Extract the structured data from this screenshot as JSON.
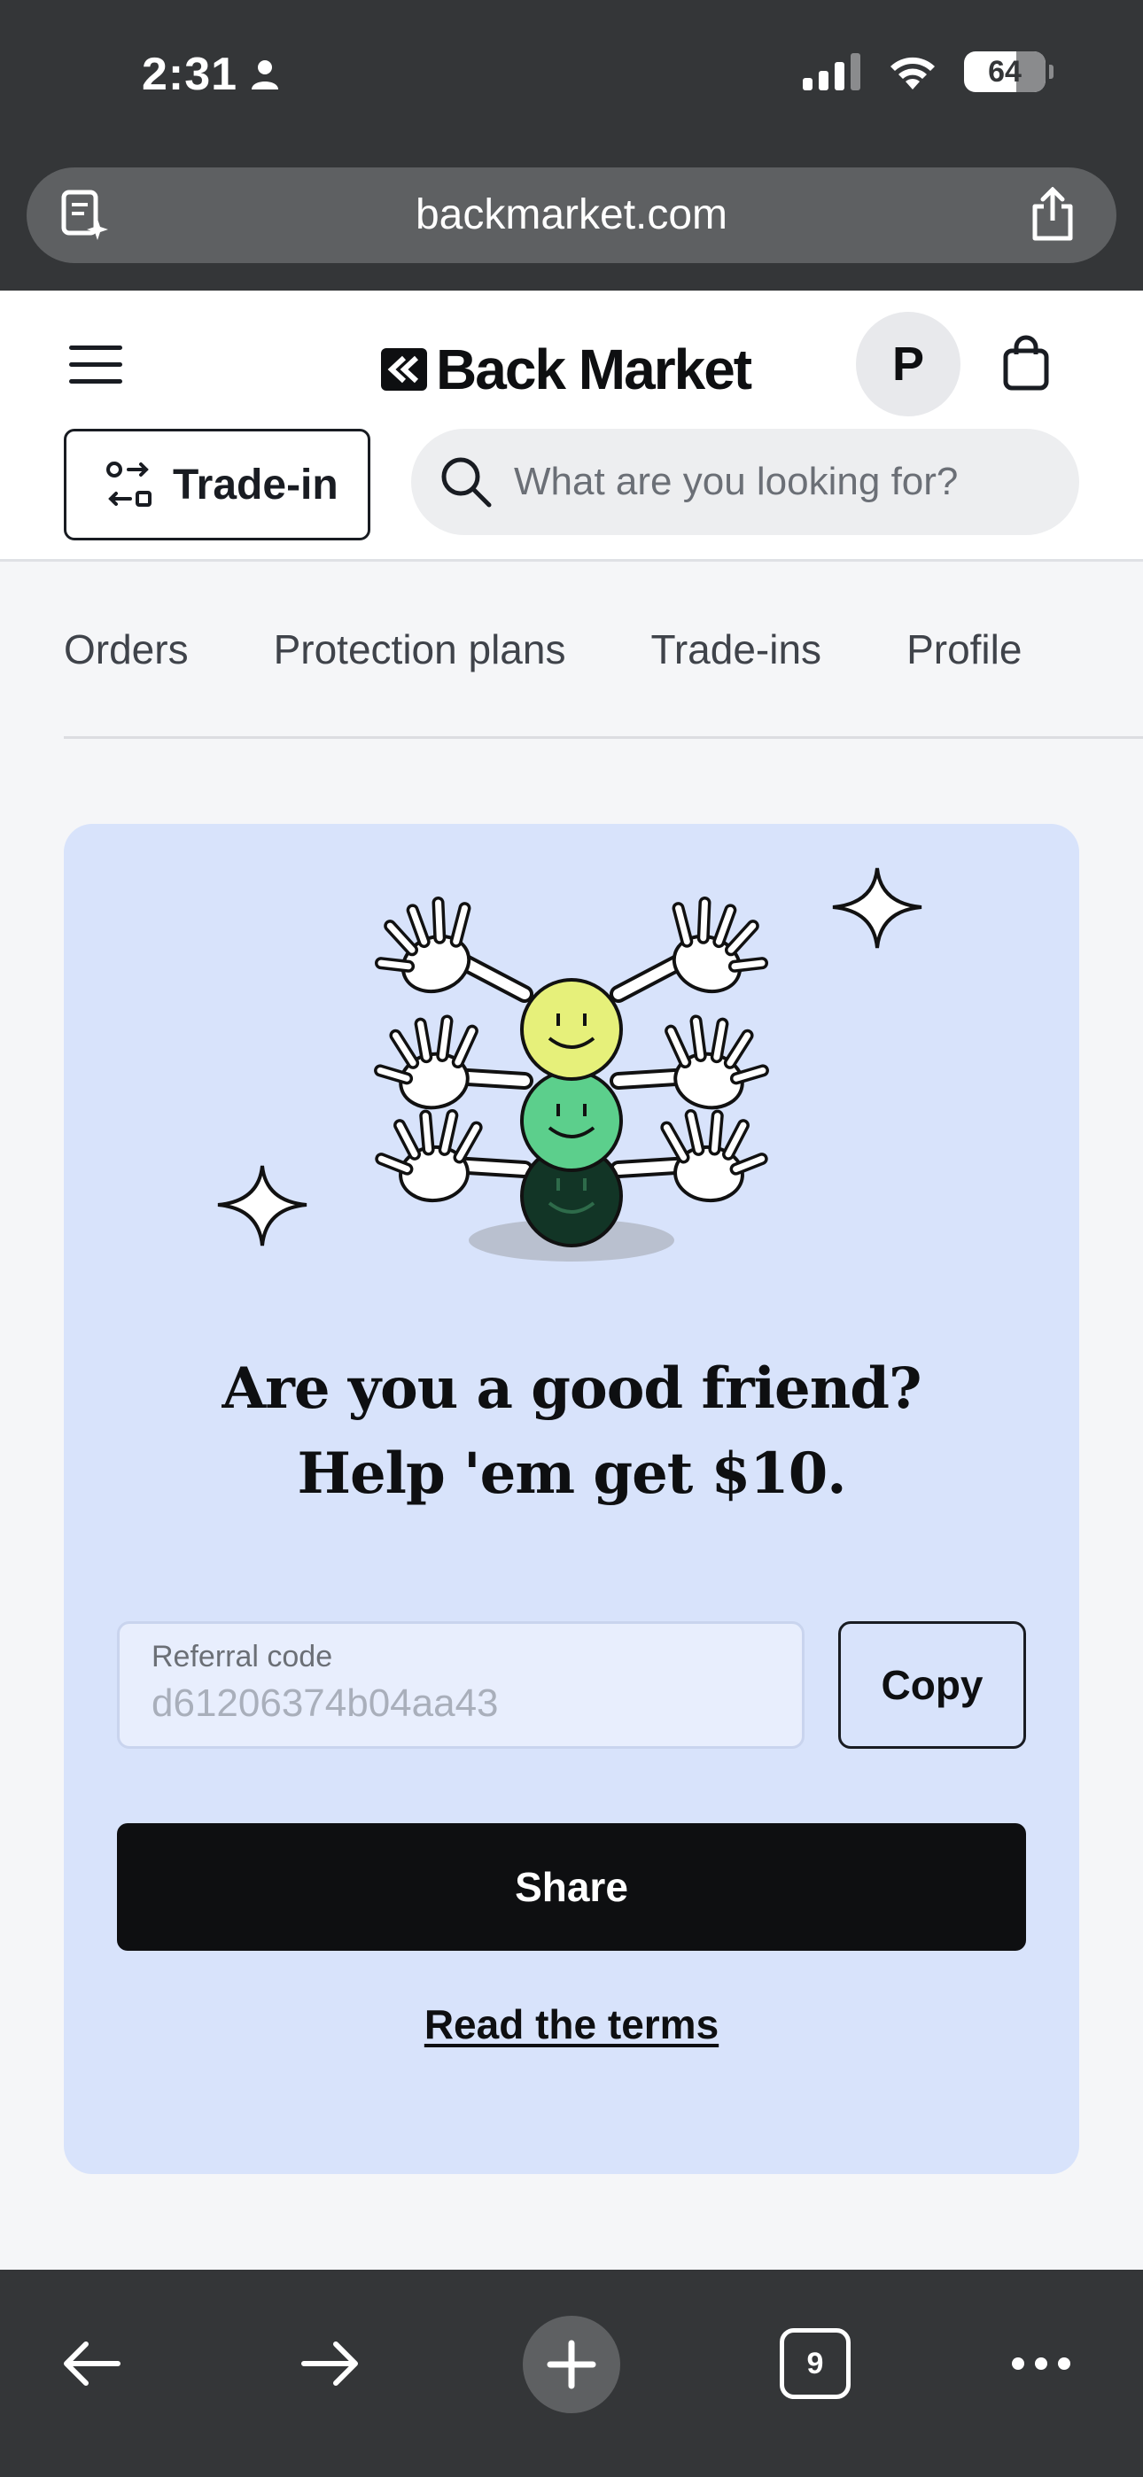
{
  "status_bar": {
    "time": "2:31",
    "battery": "64"
  },
  "browser": {
    "url": "backmarket.com",
    "open_tabs": "9"
  },
  "header": {
    "logo_text": "Back Market",
    "avatar_initial": "P",
    "trade_in_label": "Trade-in",
    "search_placeholder": "What are you looking for?"
  },
  "tabs": [
    {
      "label": "Orders"
    },
    {
      "label": "Protection plans"
    },
    {
      "label": "Trade-ins"
    },
    {
      "label": "Profile"
    }
  ],
  "referral": {
    "headline_line1": "Are you a good friend?",
    "headline_line2": "Help 'em get $10.",
    "code_label": "Referral code",
    "code_value": "d61206374b04aa43",
    "copy_label": "Copy",
    "share_label": "Share",
    "terms_label": "Read the terms"
  },
  "colors": {
    "browser_chrome": "#343638",
    "card_background": "#d8e3fb",
    "primary_button": "#0e0f11",
    "smiley_yellow": "#e6f07a",
    "smiley_green": "#5ccf8c",
    "smiley_dark": "#123526"
  },
  "icons": {
    "url_left": "reader-sparkle-icon",
    "url_right": "share-icon",
    "menu": "hamburger-icon",
    "cart": "shopping-bag-icon",
    "trade_in": "swap-icon",
    "search": "search-icon",
    "nav_back": "arrow-left-icon",
    "nav_forward": "arrow-right-icon",
    "new_tab": "plus-icon",
    "more": "ellipsis-icon"
  }
}
